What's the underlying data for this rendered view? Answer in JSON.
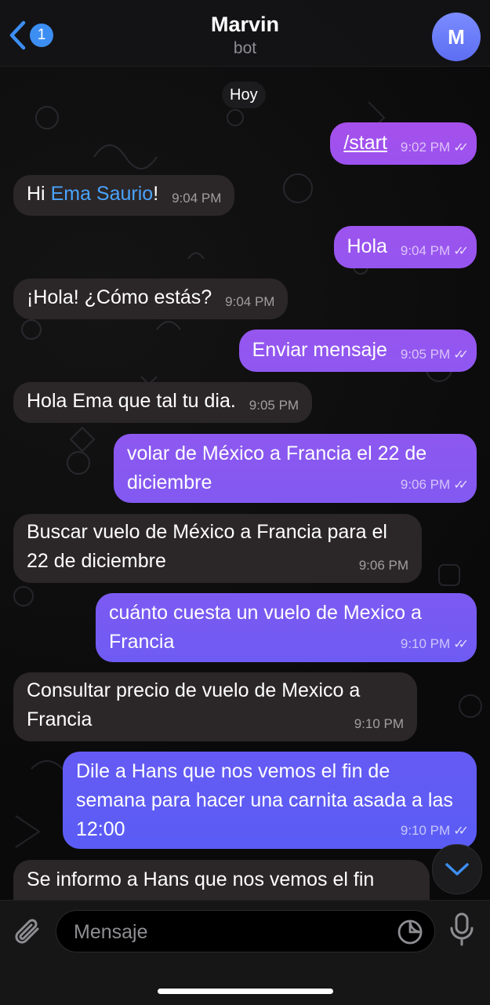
{
  "header": {
    "back_count": "1",
    "title": "Marvin",
    "subtitle": "bot",
    "avatar_letter": "M"
  },
  "date_label": "Hoy",
  "messages": [
    {
      "dir": "out",
      "text": "/start",
      "time": "9:02 PM"
    },
    {
      "dir": "in",
      "prefix": "Hi ",
      "mention": "Ema Saurio",
      "suffix": "!",
      "time": "9:04 PM"
    },
    {
      "dir": "out",
      "text": "Hola",
      "time": "9:04 PM"
    },
    {
      "dir": "in",
      "text": "¡Hola! ¿Cómo estás?",
      "time": "9:04 PM"
    },
    {
      "dir": "out",
      "text": "Enviar mensaje",
      "time": "9:05 PM"
    },
    {
      "dir": "in",
      "text": "Hola Ema que tal tu dia.",
      "time": "9:05 PM"
    },
    {
      "dir": "out",
      "text": "volar de México a Francia el 22 de diciembre",
      "time": "9:06 PM"
    },
    {
      "dir": "in",
      "text": "Buscar vuelo de México a Francia para el 22 de diciembre",
      "time": "9:06 PM"
    },
    {
      "dir": "out",
      "text": "cuánto cuesta un vuelo de Mexico a Francia",
      "time": "9:10 PM"
    },
    {
      "dir": "in",
      "text": "Consultar precio de vuelo de Mexico a Francia",
      "time": "9:10 PM"
    },
    {
      "dir": "out",
      "text": "Dile a Hans que nos vemos el fin de semana para hacer una carnita asada a las 12:00",
      "time": "9:10 PM"
    },
    {
      "dir": "in",
      "text": "Se informo a Hans que nos vemos el fin"
    }
  ],
  "composer": {
    "placeholder": "Mensaje"
  },
  "colors": {
    "outgoing_top": "#a252ec",
    "outgoing_bottom": "#4f5cf5",
    "incoming": "#2b2627",
    "link": "#4aa3ff",
    "badge": "#3d8ef3"
  },
  "icons": [
    "back-chevron-icon",
    "paperclip-icon",
    "sticker-icon",
    "microphone-icon",
    "chevron-down-icon"
  ]
}
